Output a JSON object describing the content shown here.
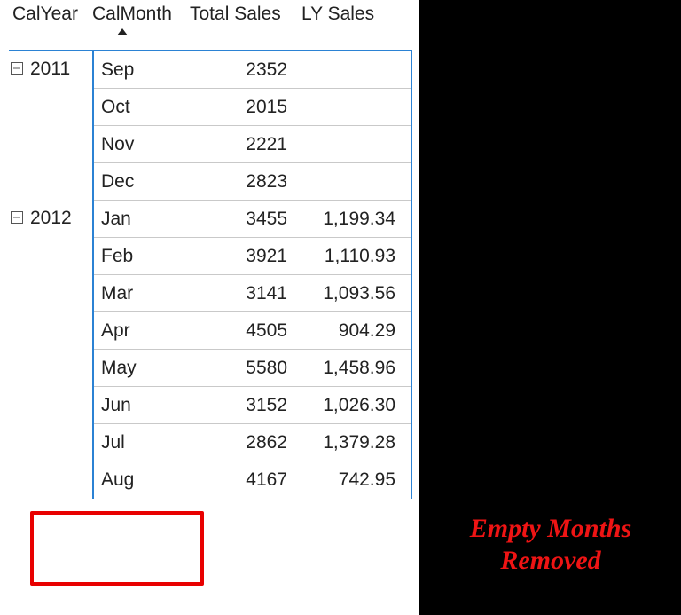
{
  "headers": {
    "year": "CalYear",
    "month": "CalMonth",
    "sales": "Total Sales",
    "ly": "LY Sales"
  },
  "groups": [
    {
      "year": "2011",
      "rows": [
        {
          "month": "Sep",
          "sales": "2352",
          "ly": ""
        },
        {
          "month": "Oct",
          "sales": "2015",
          "ly": ""
        },
        {
          "month": "Nov",
          "sales": "2221",
          "ly": ""
        },
        {
          "month": "Dec",
          "sales": "2823",
          "ly": ""
        }
      ]
    },
    {
      "year": "2012",
      "rows": [
        {
          "month": "Jan",
          "sales": "3455",
          "ly": "1,199.34"
        },
        {
          "month": "Feb",
          "sales": "3921",
          "ly": "1,110.93"
        },
        {
          "month": "Mar",
          "sales": "3141",
          "ly": "1,093.56"
        },
        {
          "month": "Apr",
          "sales": "4505",
          "ly": "904.29"
        },
        {
          "month": "May",
          "sales": "5580",
          "ly": "1,458.96"
        },
        {
          "month": "Jun",
          "sales": "3152",
          "ly": "1,026.30"
        },
        {
          "month": "Jul",
          "sales": "2862",
          "ly": "1,379.28"
        },
        {
          "month": "Aug",
          "sales": "4167",
          "ly": "742.95"
        }
      ]
    }
  ],
  "annotation": {
    "line1": "Empty Months",
    "line2": "Removed"
  }
}
